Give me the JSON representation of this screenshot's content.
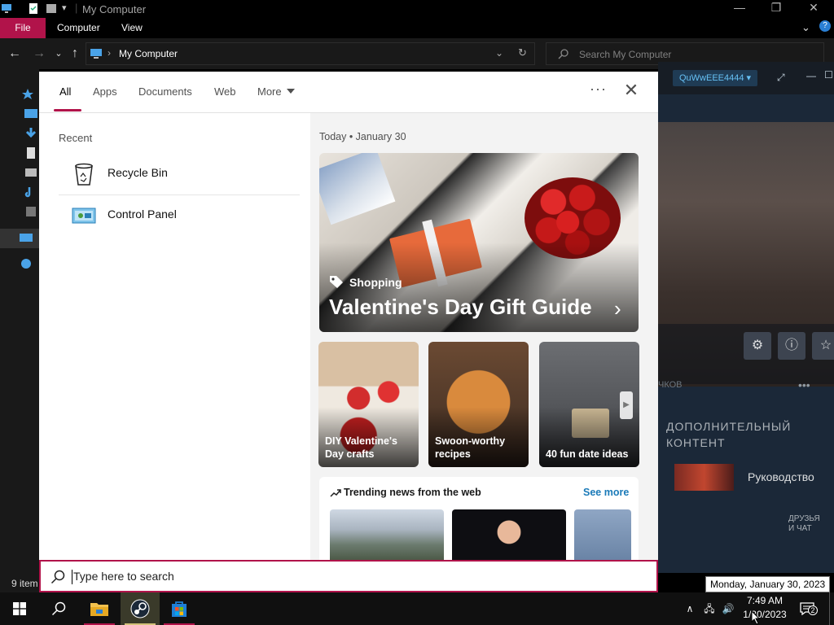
{
  "explorer": {
    "title": "My Computer",
    "ribbon_tabs": [
      "File",
      "Computer",
      "View"
    ],
    "address": "My Computer",
    "search_placeholder": "Search My Computer",
    "status": "9 item"
  },
  "steam": {
    "username": "QuWwEEE4444",
    "section_title_line1": "ДОПОЛНИТЕЛЬНЫЙ",
    "section_title_line2": "КОНТЕНТ",
    "achievements_label": "ЧКОВ",
    "guide_label": "Руководство",
    "friends_line1": "ДРУЗЬЯ",
    "friends_line2": "И ЧАТ"
  },
  "search_flyout": {
    "tabs": [
      "All",
      "Apps",
      "Documents",
      "Web",
      "More"
    ],
    "active_tab": "All",
    "recent_heading": "Recent",
    "recent_items": [
      {
        "label": "Recycle Bin",
        "icon": "recycle-bin-icon"
      },
      {
        "label": "Control Panel",
        "icon": "control-panel-icon"
      }
    ],
    "today_heading": "Today  •  January 30",
    "hero": {
      "category": "Shopping",
      "title": "Valentine's Day Gift Guide"
    },
    "cards": [
      {
        "label": "DIY Valentine's Day crafts"
      },
      {
        "label": "Swoon-worthy recipes"
      },
      {
        "label": "40 fun date ideas"
      }
    ],
    "trending_heading": "Trending news from the web",
    "see_more": "See more",
    "search_placeholder": "Type here to search"
  },
  "taskbar": {
    "time": "7:49 AM",
    "date": "1/30/2023",
    "tooltip": "Monday, January 30, 2023",
    "notification_count": "2"
  },
  "colors": {
    "accent": "#b1134a",
    "steam_bg": "#1b2838",
    "link": "#1a7ab8"
  }
}
